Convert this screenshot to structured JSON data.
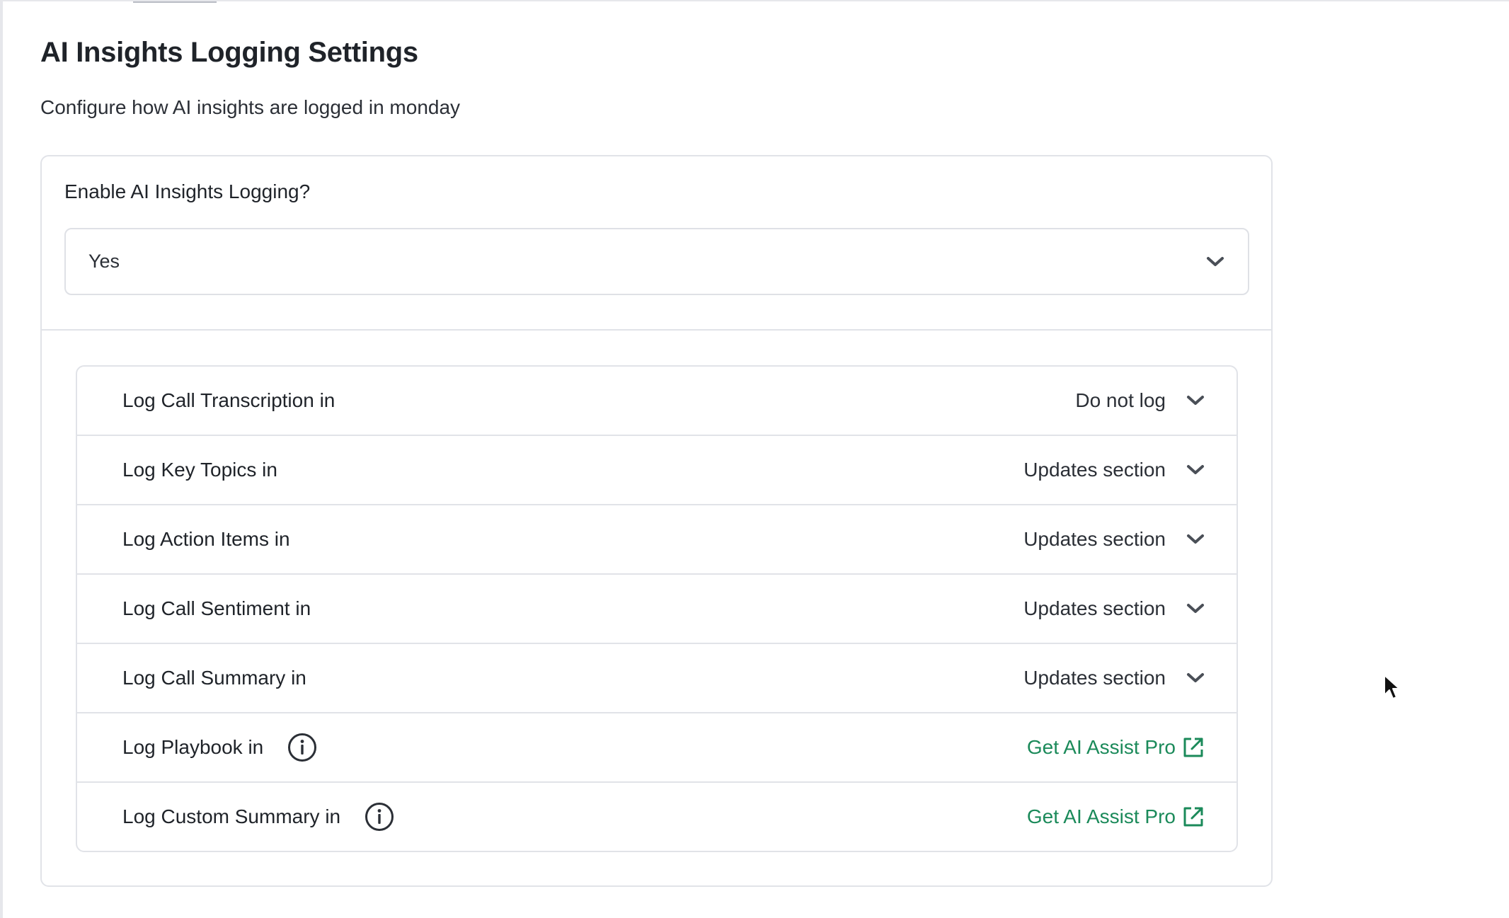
{
  "header": {
    "title": "AI Insights Logging Settings",
    "subtitle": "Configure how AI insights are logged in monday"
  },
  "enable": {
    "label": "Enable AI Insights Logging?",
    "value": "Yes"
  },
  "rows": [
    {
      "label": "Log Call Transcription in",
      "value": "Do not log",
      "type": "select"
    },
    {
      "label": "Log Key Topics in",
      "value": "Updates section",
      "type": "select"
    },
    {
      "label": "Log Action Items in",
      "value": "Updates section",
      "type": "select"
    },
    {
      "label": "Log Call Sentiment in",
      "value": "Updates section",
      "type": "select"
    },
    {
      "label": "Log Call Summary in",
      "value": "Updates section",
      "type": "select"
    },
    {
      "label": "Log Playbook in",
      "value": "Get AI Assist Pro",
      "type": "upgrade",
      "info": true
    },
    {
      "label": "Log Custom Summary in",
      "value": "Get AI Assist Pro",
      "type": "upgrade",
      "info": true
    }
  ],
  "colors": {
    "link": "#1b8a5a",
    "border": "#e1e3e8",
    "text": "#1f2329"
  },
  "icons": {
    "chevron": "chevron-down-icon",
    "info": "info-icon",
    "external": "external-link-icon"
  }
}
